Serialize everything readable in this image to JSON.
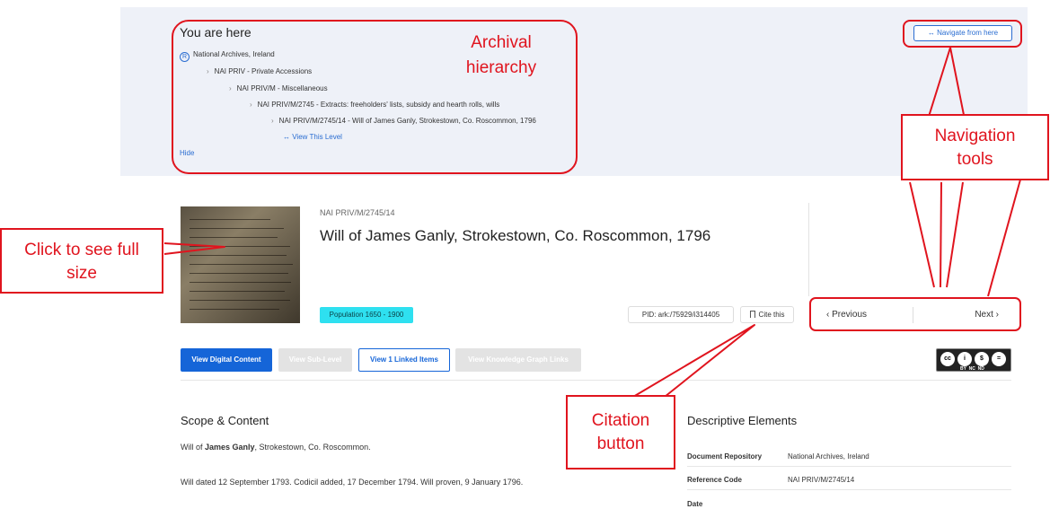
{
  "hierarchy": {
    "heading": "You are here",
    "crumbs": [
      "National Archives, Ireland",
      "NAI PRIV - Private Accessions",
      "NAI PRIV/M - Miscellaneous",
      "NAI PRIV/M/2745 - Extracts: freeholders' lists, subsidy and hearth rolls, wills",
      "NAI PRIV/M/2745/14 - Will of James Ganly, Strokestown, Co. Roscommon, 1796"
    ],
    "root_icon": "R",
    "view_level": "↔ View This Level",
    "hide": "Hide"
  },
  "navigate_from_here": "↔ Navigate from here",
  "item": {
    "ref_code": "NAI PRIV/M/2745/14",
    "title": "Will of James Ganly, Strokestown, Co. Roscommon, 1796",
    "badge": "Population 1650 - 1900",
    "pid": "PID: ark:/75929/i314405",
    "cite": "Cite this",
    "previous": "‹   Previous",
    "next": "Next   ›"
  },
  "buttons": {
    "view_digital": "View Digital Content",
    "view_sub": "View Sub-Level",
    "view_linked": "View 1 Linked Items",
    "view_kg": "View Knowledge Graph Links"
  },
  "license": {
    "cc": "cc",
    "by": "i",
    "nc": "$",
    "nd": "=",
    "labels": "BY  NC  ND"
  },
  "scope": {
    "title": "Scope & Content",
    "p1_pre": "Will of ",
    "p1_bold": "James Ganly",
    "p1_post": ", Strokestown, Co. Roscommon.",
    "p2": "Will dated 12 September 1793. Codicil added, 17 December 1794. Will proven, 9 January 1796."
  },
  "descriptive": {
    "title": "Descriptive Elements",
    "rows": [
      {
        "k": "Document Repository",
        "v": "National Archives, Ireland"
      },
      {
        "k": "Reference Code",
        "v": "NAI PRIV/M/2745/14"
      },
      {
        "k": "Date",
        "v": ""
      }
    ]
  },
  "callouts": {
    "archival": "Archival hierarchy",
    "navigation": "Navigation tools",
    "click": "Click to see full size",
    "citation": "Citation button"
  },
  "colors": {
    "accent": "#1565d8",
    "annotation": "#e0141e",
    "badge": "#2ee0f0"
  }
}
